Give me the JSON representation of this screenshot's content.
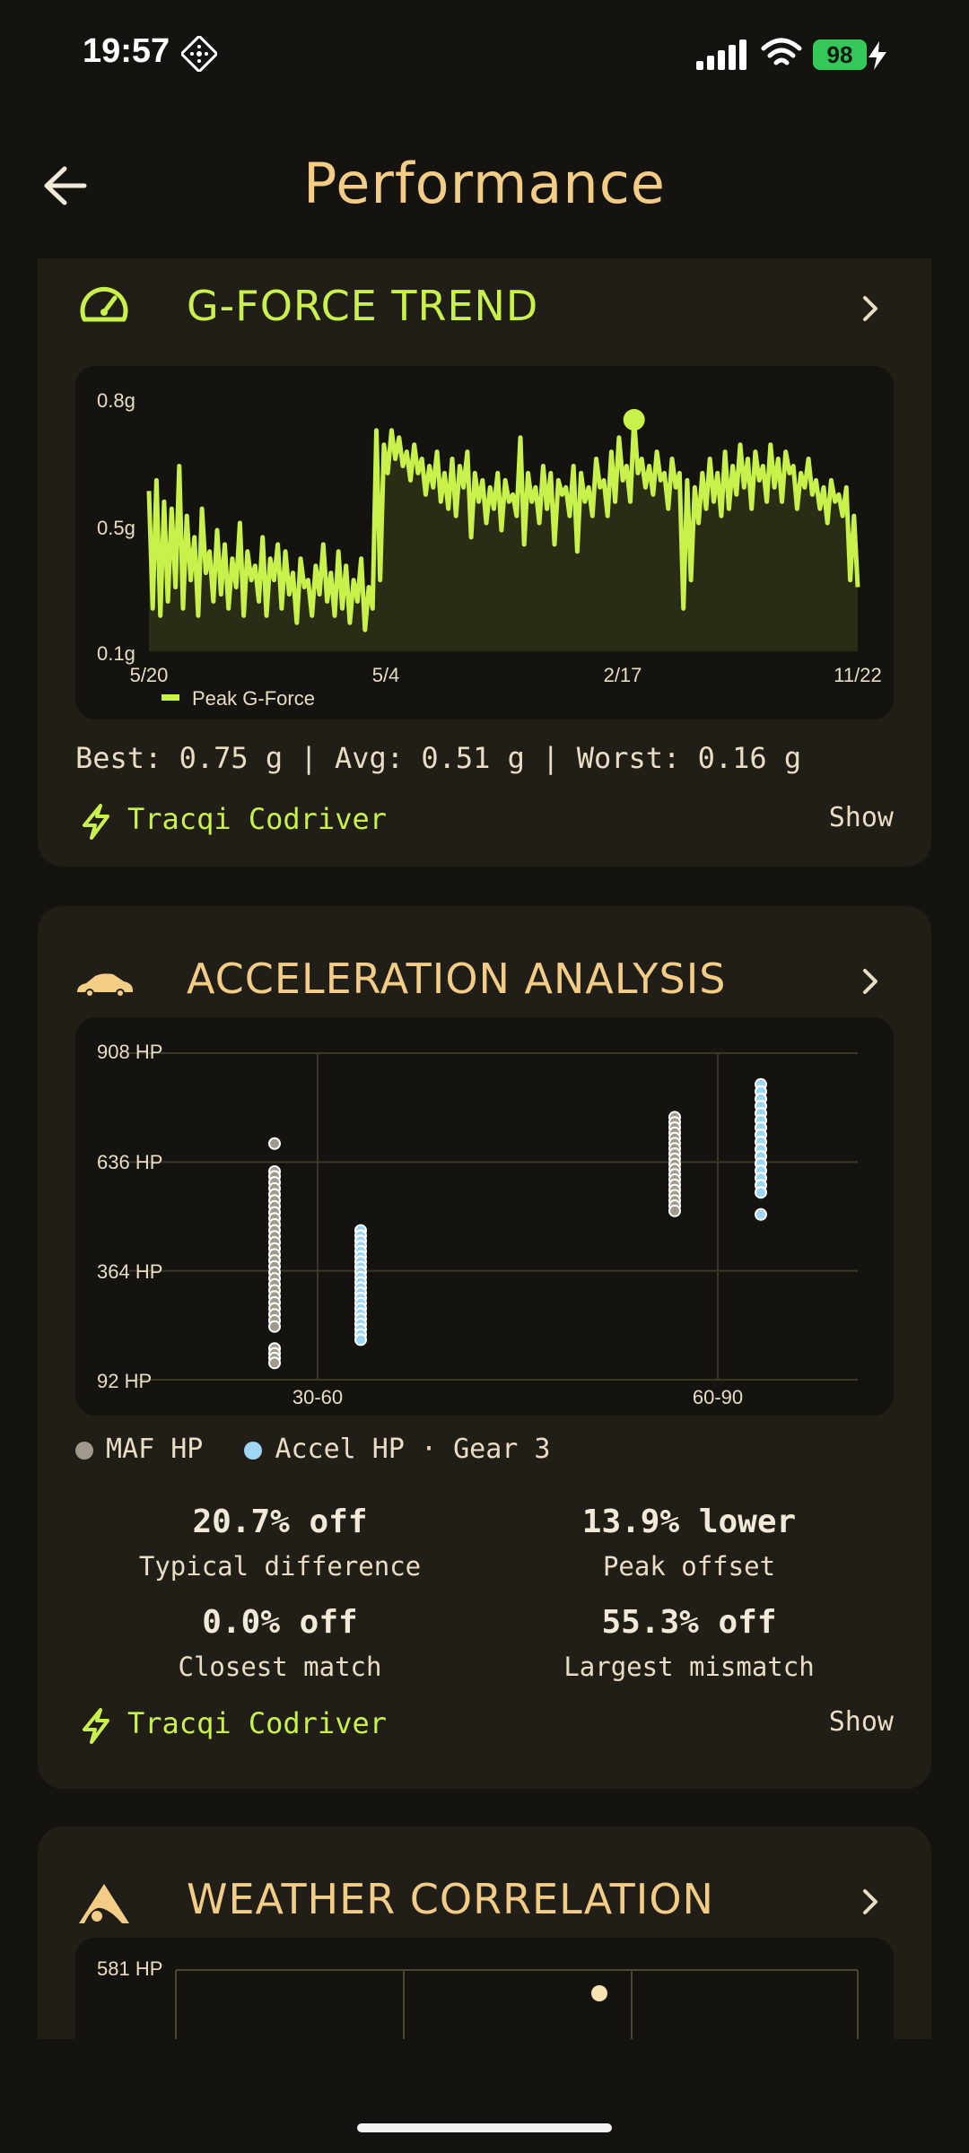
{
  "status_bar": {
    "time": "19:57",
    "battery": "98"
  },
  "header": {
    "title": "Performance"
  },
  "gforce": {
    "title": "G-FORCE TREND",
    "summary": "Best: 0.75 g | Avg: 0.51 g | Worst: 0.16 g",
    "codriver_label": "Tracqi Codriver",
    "show_label": "Show",
    "chart_data": {
      "type": "area",
      "ylim": [
        0.1,
        0.8
      ],
      "y_ticks": [
        "0.8g",
        "0.5g",
        "0.1g"
      ],
      "x_ticks": [
        "5/20",
        "5/4",
        "2/17",
        "11/22"
      ],
      "series": [
        {
          "name": "Peak G-Force",
          "values": [
            0.55,
            0.22,
            0.58,
            0.2,
            0.52,
            0.24,
            0.5,
            0.28,
            0.62,
            0.22,
            0.48,
            0.3,
            0.42,
            0.2,
            0.5,
            0.32,
            0.38,
            0.24,
            0.44,
            0.26,
            0.4,
            0.22,
            0.36,
            0.28,
            0.46,
            0.2,
            0.38,
            0.3,
            0.34,
            0.24,
            0.42,
            0.2,
            0.36,
            0.3,
            0.4,
            0.22,
            0.38,
            0.26,
            0.32,
            0.18,
            0.36,
            0.28,
            0.3,
            0.2,
            0.34,
            0.26,
            0.4,
            0.24,
            0.32,
            0.2,
            0.38,
            0.22,
            0.34,
            0.18,
            0.3,
            0.24,
            0.36,
            0.16,
            0.28,
            0.22,
            0.72,
            0.3,
            0.68,
            0.6,
            0.72,
            0.64,
            0.7,
            0.62,
            0.66,
            0.58,
            0.68,
            0.6,
            0.64,
            0.54,
            0.62,
            0.56,
            0.66,
            0.52,
            0.6,
            0.5,
            0.64,
            0.48,
            0.62,
            0.56,
            0.66,
            0.42,
            0.6,
            0.52,
            0.58,
            0.46,
            0.56,
            0.5,
            0.6,
            0.44,
            0.58,
            0.52,
            0.54,
            0.48,
            0.7,
            0.4,
            0.6,
            0.52,
            0.56,
            0.46,
            0.62,
            0.5,
            0.6,
            0.4,
            0.58,
            0.54,
            0.56,
            0.48,
            0.62,
            0.38,
            0.6,
            0.52,
            0.56,
            0.48,
            0.64,
            0.56,
            0.58,
            0.48,
            0.66,
            0.52,
            0.7,
            0.58,
            0.62,
            0.52,
            0.75,
            0.6,
            0.64,
            0.56,
            0.62,
            0.54,
            0.66,
            0.58,
            0.6,
            0.5,
            0.64,
            0.56,
            0.6,
            0.22,
            0.58,
            0.3,
            0.56,
            0.46,
            0.6,
            0.5,
            0.64,
            0.52,
            0.6,
            0.48,
            0.66,
            0.5,
            0.62,
            0.54,
            0.68,
            0.56,
            0.64,
            0.5,
            0.66,
            0.58,
            0.62,
            0.52,
            0.68,
            0.56,
            0.64,
            0.52,
            0.66,
            0.6,
            0.62,
            0.5,
            0.6,
            0.56,
            0.64,
            0.54,
            0.58,
            0.5,
            0.56,
            0.46,
            0.58,
            0.52,
            0.54,
            0.48,
            0.56,
            0.3,
            0.48,
            0.28
          ]
        }
      ],
      "peak_index": 128,
      "legend": "Peak G-Force"
    }
  },
  "accel": {
    "title": "ACCELERATION ANALYSIS",
    "legend": {
      "maf": "MAF HP",
      "accel": "Accel HP · Gear 3"
    },
    "chart_data": {
      "type": "scatter",
      "ylim": [
        92,
        908
      ],
      "y_ticks": [
        "908 HP",
        "636 HP",
        "364 HP",
        "92 HP"
      ],
      "categories": [
        "30-60",
        "60-90"
      ],
      "series": [
        {
          "name": "MAF HP",
          "color": "#a09a8c",
          "points": [
            [
              "30-60",
              682
            ],
            [
              "30-60",
              612
            ],
            [
              "30-60",
              600
            ],
            [
              "30-60",
              585
            ],
            [
              "30-60",
              570
            ],
            [
              "30-60",
              555
            ],
            [
              "30-60",
              540
            ],
            [
              "30-60",
              525
            ],
            [
              "30-60",
              510
            ],
            [
              "30-60",
              495
            ],
            [
              "30-60",
              480
            ],
            [
              "30-60",
              465
            ],
            [
              "30-60",
              450
            ],
            [
              "30-60",
              435
            ],
            [
              "30-60",
              420
            ],
            [
              "30-60",
              405
            ],
            [
              "30-60",
              390
            ],
            [
              "30-60",
              375
            ],
            [
              "30-60",
              360
            ],
            [
              "30-60",
              345
            ],
            [
              "30-60",
              330
            ],
            [
              "30-60",
              315
            ],
            [
              "30-60",
              300
            ],
            [
              "30-60",
              285
            ],
            [
              "30-60",
              270
            ],
            [
              "30-60",
              255
            ],
            [
              "30-60",
              240
            ],
            [
              "30-60",
              225
            ],
            [
              "30-60",
              170
            ],
            [
              "30-60",
              158
            ],
            [
              "30-60",
              146
            ],
            [
              "30-60",
              134
            ],
            [
              "60-90",
              748
            ],
            [
              "60-90",
              735
            ],
            [
              "60-90",
              722
            ],
            [
              "60-90",
              709
            ],
            [
              "60-90",
              696
            ],
            [
              "60-90",
              683
            ],
            [
              "60-90",
              670
            ],
            [
              "60-90",
              657
            ],
            [
              "60-90",
              644
            ],
            [
              "60-90",
              631
            ],
            [
              "60-90",
              618
            ],
            [
              "60-90",
              605
            ],
            [
              "60-90",
              592
            ],
            [
              "60-90",
              579
            ],
            [
              "60-90",
              566
            ],
            [
              "60-90",
              553
            ],
            [
              "60-90",
              540
            ],
            [
              "60-90",
              527
            ],
            [
              "60-90",
              514
            ]
          ]
        },
        {
          "name": "Accel HP",
          "color": "#9fd6f5",
          "points": [
            [
              "30-60",
              465
            ],
            [
              "30-60",
              452
            ],
            [
              "30-60",
              439
            ],
            [
              "30-60",
              426
            ],
            [
              "30-60",
              413
            ],
            [
              "30-60",
              400
            ],
            [
              "30-60",
              387
            ],
            [
              "30-60",
              374
            ],
            [
              "30-60",
              361
            ],
            [
              "30-60",
              348
            ],
            [
              "30-60",
              335
            ],
            [
              "30-60",
              322
            ],
            [
              "30-60",
              309
            ],
            [
              "30-60",
              296
            ],
            [
              "30-60",
              283
            ],
            [
              "30-60",
              270
            ],
            [
              "30-60",
              257
            ],
            [
              "30-60",
              244
            ],
            [
              "30-60",
              231
            ],
            [
              "30-60",
              218
            ],
            [
              "30-60",
              205
            ],
            [
              "30-60",
              192
            ],
            [
              "60-90",
              830
            ],
            [
              "60-90",
              812
            ],
            [
              "60-90",
              794
            ],
            [
              "60-90",
              776
            ],
            [
              "60-90",
              758
            ],
            [
              "60-90",
              740
            ],
            [
              "60-90",
              722
            ],
            [
              "60-90",
              704
            ],
            [
              "60-90",
              686
            ],
            [
              "60-90",
              668
            ],
            [
              "60-90",
              650
            ],
            [
              "60-90",
              632
            ],
            [
              "60-90",
              614
            ],
            [
              "60-90",
              596
            ],
            [
              "60-90",
              578
            ],
            [
              "60-90",
              560
            ],
            [
              "60-90",
              505
            ]
          ]
        }
      ]
    },
    "stats": [
      {
        "value": "20.7% off",
        "label": "Typical difference"
      },
      {
        "value": "13.9% lower",
        "label": "Peak offset"
      },
      {
        "value": "0.0% off",
        "label": "Closest match"
      },
      {
        "value": "55.3% off",
        "label": "Largest mismatch"
      }
    ],
    "codriver_label": "Tracqi Codriver",
    "show_label": "Show"
  },
  "weather": {
    "title": "WEATHER CORRELATION",
    "chart_data": {
      "type": "scatter",
      "y_ticks": [
        "581 HP"
      ],
      "points": [
        [
          0.65,
          560
        ]
      ]
    }
  },
  "colors": {
    "lime": "#c9f14c",
    "gold": "#f3cd86",
    "card": "#211e18"
  }
}
